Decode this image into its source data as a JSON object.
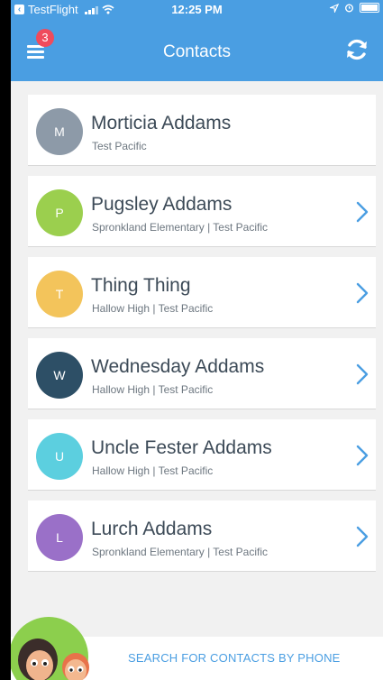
{
  "status_bar": {
    "carrier": "TestFlight",
    "time": "12:25 PM"
  },
  "header": {
    "title": "Contacts",
    "menu_badge_count": "3",
    "menu_icon": "hamburger-menu-icon",
    "refresh_icon": "refresh-icon"
  },
  "colors": {
    "accent": "#4a9ee2",
    "badge": "#ef4b5c"
  },
  "contacts": [
    {
      "initial": "M",
      "name": "Morticia Addams",
      "subtitle": "Test Pacific",
      "color": "#8d9aa8",
      "has_chevron": false
    },
    {
      "initial": "P",
      "name": "Pugsley Addams",
      "subtitle": "Spronkland Elementary | Test Pacific",
      "color": "#9bcf4e",
      "has_chevron": true
    },
    {
      "initial": "T",
      "name": "Thing Thing",
      "subtitle": "Hallow High | Test Pacific",
      "color": "#f3c45b",
      "has_chevron": true
    },
    {
      "initial": "W",
      "name": "Wednesday Addams",
      "subtitle": "Hallow High | Test Pacific",
      "color": "#2d4f66",
      "has_chevron": true
    },
    {
      "initial": "U",
      "name": "Uncle Fester Addams",
      "subtitle": "Hallow High | Test Pacific",
      "color": "#5ccfdf",
      "has_chevron": true
    },
    {
      "initial": "L",
      "name": "Lurch Addams",
      "subtitle": "Spronkland Elementary | Test Pacific",
      "color": "#9a70c8",
      "has_chevron": true
    }
  ],
  "footer": {
    "link_label": "SEARCH FOR CONTACTS BY PHONE"
  }
}
